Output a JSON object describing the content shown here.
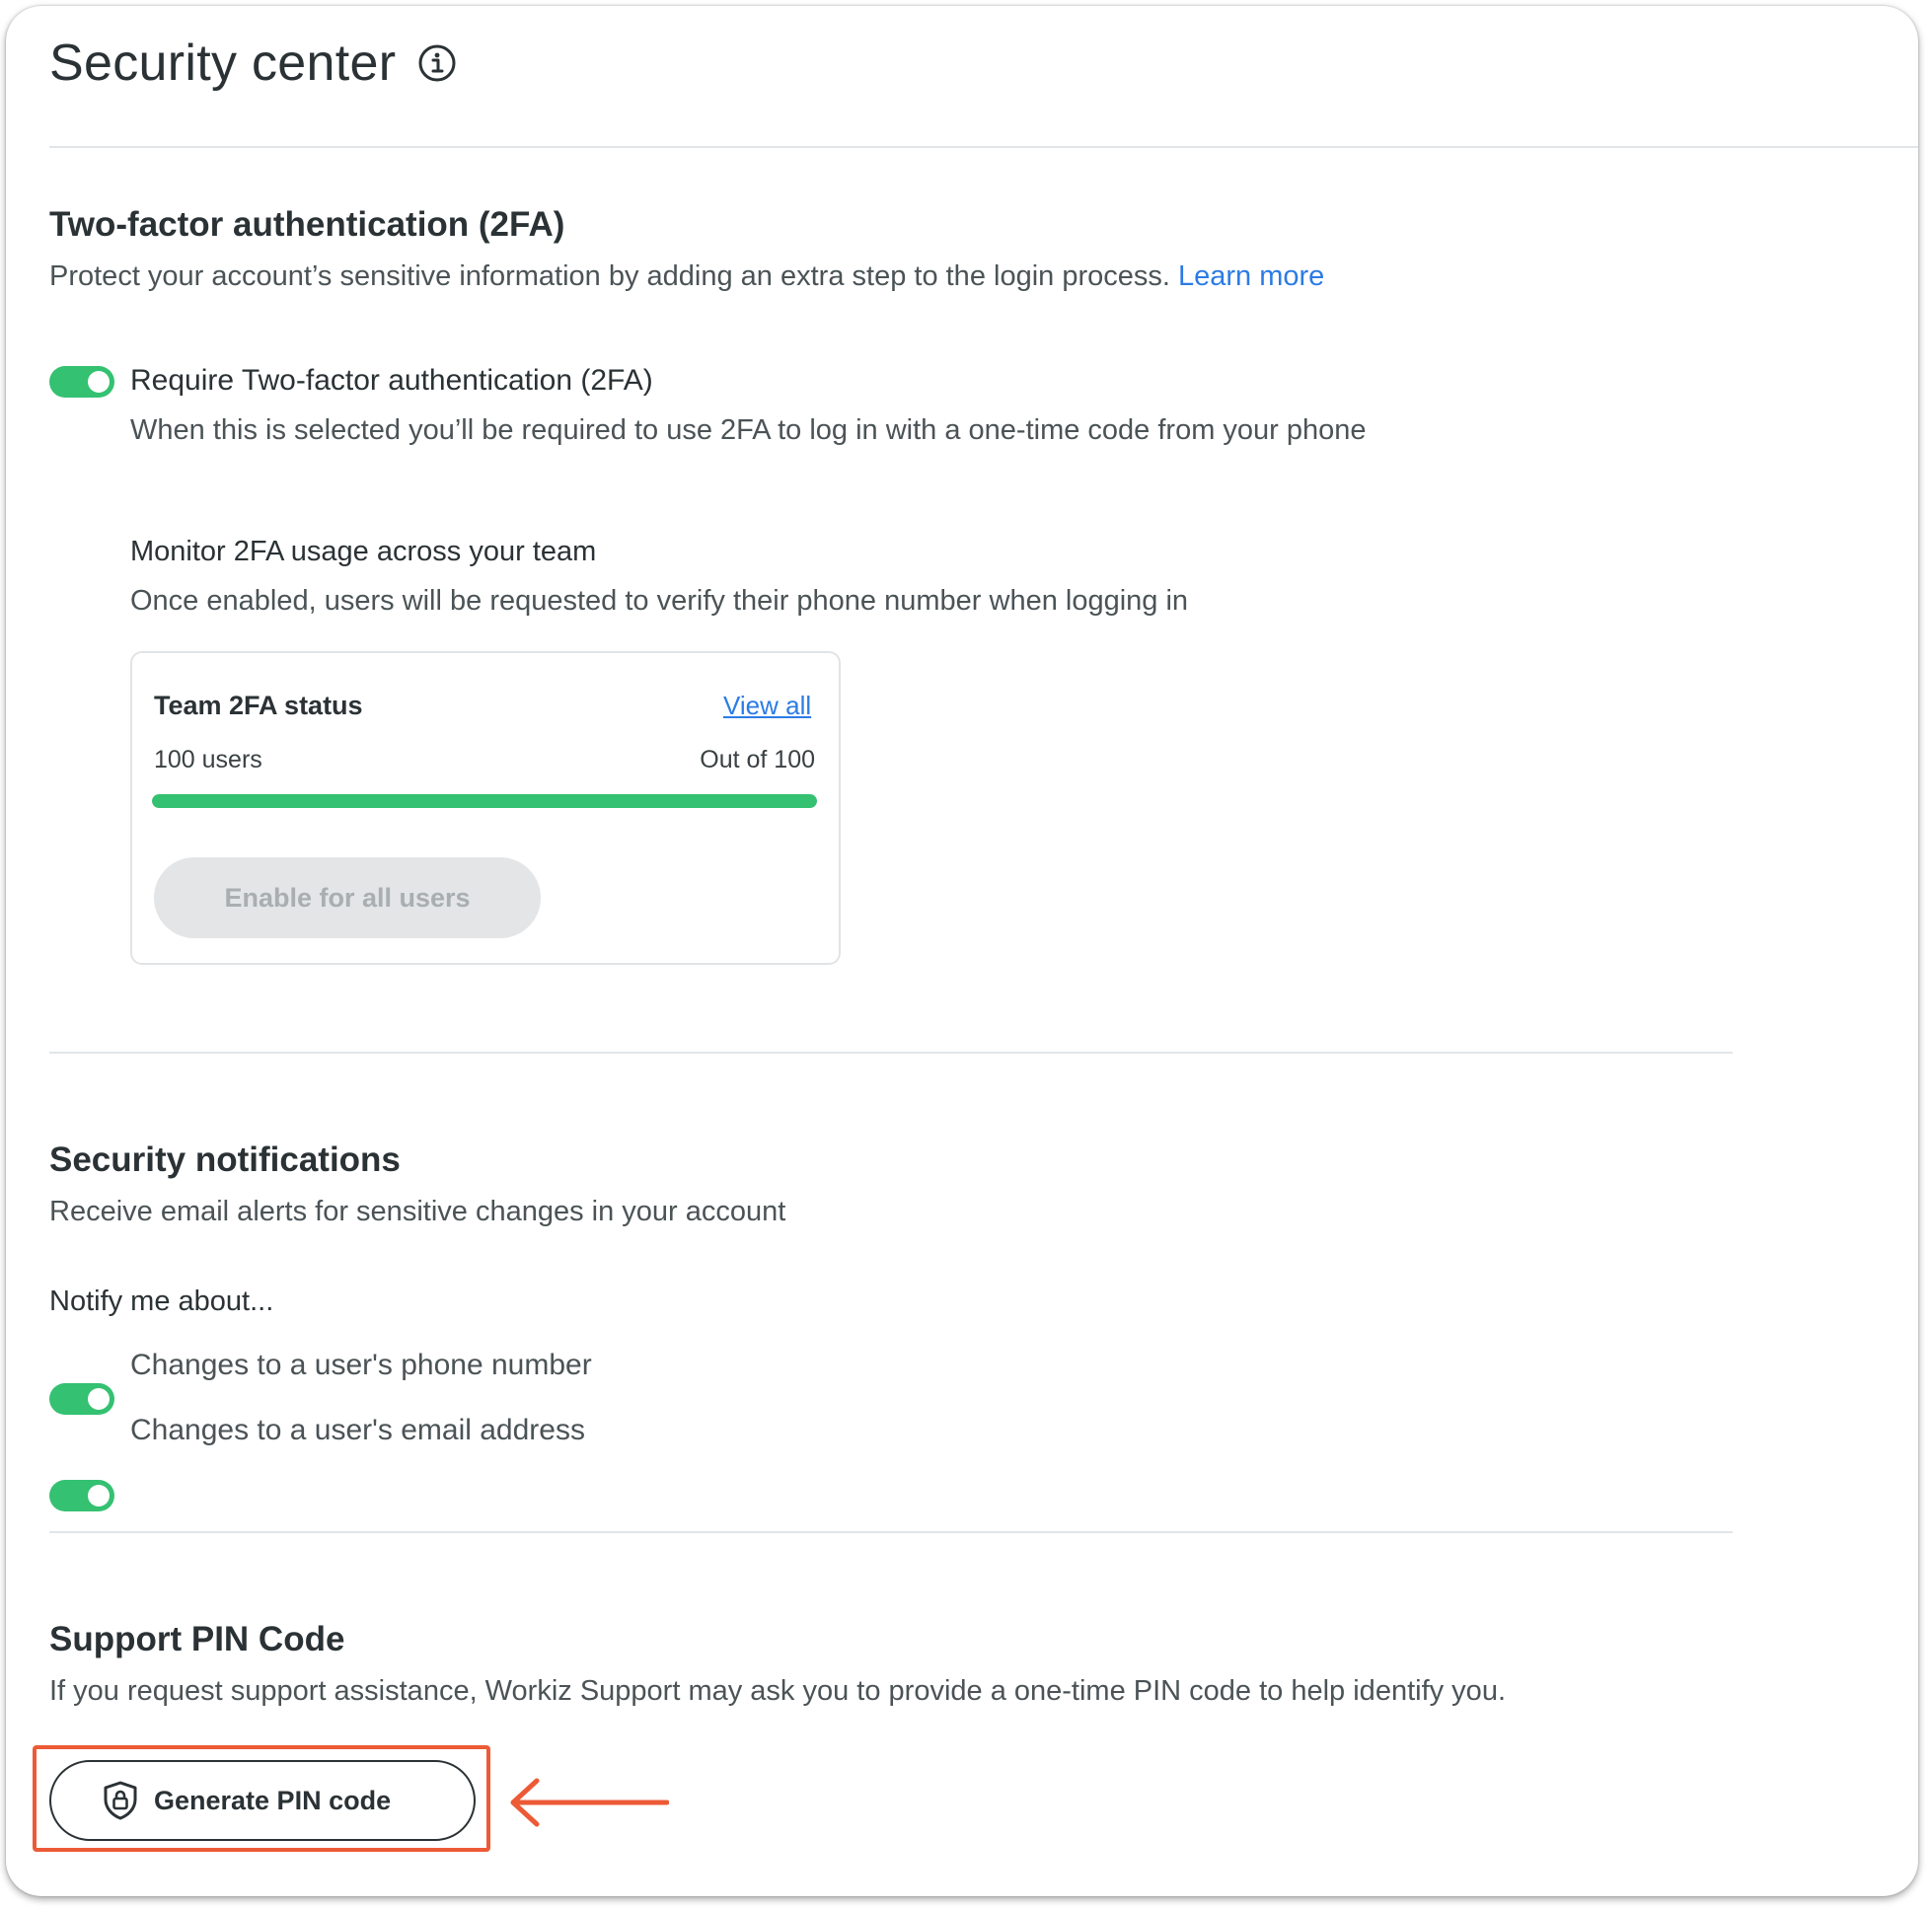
{
  "header": {
    "title": "Security center"
  },
  "two_factor": {
    "title": "Two-factor authentication (2FA)",
    "description": "Protect your account’s sensitive information by adding an extra step to the login process.",
    "learn_more": "Learn more",
    "require_toggle": {
      "on": true,
      "label": "Require Two-factor authentication (2FA)",
      "description": "When this is selected you’ll be required to use 2FA to log in with a one-time code from your phone"
    },
    "monitor": {
      "title": "Monitor 2FA usage across your team",
      "description": "Once enabled, users will be requested to verify their phone number when logging in"
    },
    "team_status": {
      "title": "Team 2FA status",
      "view_all": "View all",
      "users_text": "100 users",
      "out_of_text": "Out of 100",
      "progress_percent": 100,
      "enable_button": "Enable for all users"
    }
  },
  "notifications": {
    "title": "Security notifications",
    "description": "Receive email alerts for sensitive changes in your account",
    "notify_label": "Notify me about...",
    "items": [
      {
        "label": "Changes to a user's phone number",
        "on": true
      },
      {
        "label": "Changes to a user's email address",
        "on": true
      }
    ]
  },
  "support_pin": {
    "title": "Support PIN Code",
    "description": "If you request support assistance, Workiz Support may ask you to provide a one-time PIN code to help identify you.",
    "button": "Generate PIN code"
  },
  "colors": {
    "accent_green": "#34c171",
    "link_blue": "#2c7be5",
    "highlight_orange": "#ec5a36"
  },
  "icons": {
    "title_info": "info-icon",
    "pin_button": "shield-lock-icon",
    "annotation": "arrow-left-icon"
  }
}
